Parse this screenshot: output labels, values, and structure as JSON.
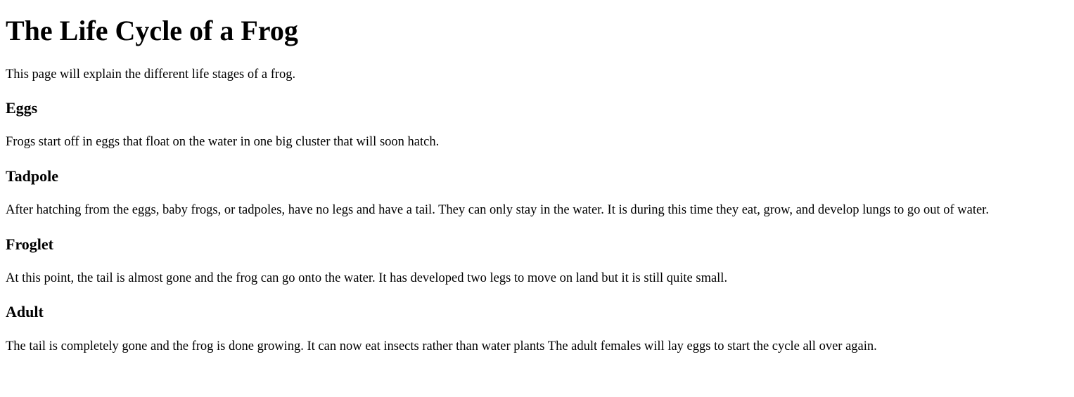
{
  "page": {
    "title": "The Life Cycle of a Frog",
    "intro": "This page will explain the different life stages of a frog."
  },
  "sections": [
    {
      "heading": "Eggs",
      "text": "Frogs start off in eggs that float on the water in one big cluster that will soon hatch."
    },
    {
      "heading": "Tadpole",
      "text": "After hatching from the eggs, baby frogs, or tadpoles, have no legs and have a tail. They can only stay in the water. It is during this time they eat, grow, and develop lungs to go out of water."
    },
    {
      "heading": "Froglet",
      "text": "At this point, the tail is almost gone and the frog can go onto the water. It has developed two legs to move on land but it is still quite small."
    },
    {
      "heading": "Adult",
      "text": "The tail is completely gone and the frog is done growing. It can now eat insects rather than water plants The adult females will lay eggs to start the cycle all over again."
    }
  ]
}
